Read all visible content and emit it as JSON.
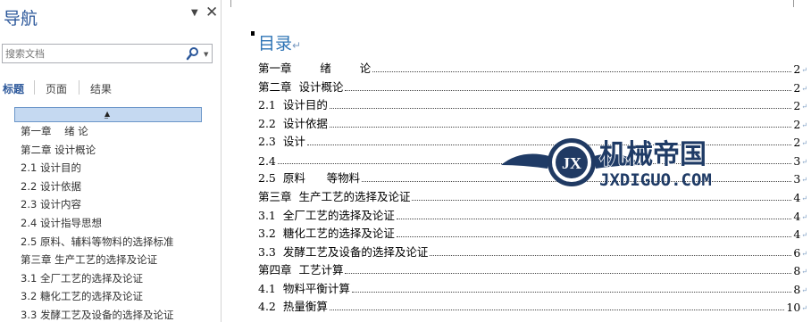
{
  "nav": {
    "title": "导航",
    "search_placeholder": "搜索文档",
    "tabs": [
      "标题",
      "页面",
      "结果"
    ],
    "items": [
      "第一章    绪 论",
      "第二章 设计概论",
      "2.1 设计目的",
      "2.2 设计依据",
      "2.3 设计内容",
      "2.4 设计指导思想",
      "2.5 原料、辅料等物料的选择标准",
      "第三章 生产工艺的选择及论证",
      "3.1 全厂工艺的选择及论证",
      "3.2 糖化工艺的选择及论证",
      "3.3 发酵工艺及设备的选择及论证"
    ]
  },
  "document": {
    "toc_title": "目录",
    "toc": [
      {
        "text": "第一章        绪        论",
        "page": "2"
      },
      {
        "text": "第二章  设计概论",
        "page": "2"
      },
      {
        "text": "2.1  设计目的",
        "page": "2"
      },
      {
        "text": "2.2  设计依据",
        "page": "2"
      },
      {
        "text": "2.3  设计",
        "page": "2"
      },
      {
        "text": "2.4",
        "page": "3"
      },
      {
        "text": "2.5  原料      等物料",
        "page": "3"
      },
      {
        "text": "第三章  生产工艺的选择及论证",
        "page": "4"
      },
      {
        "text": "3.1  全厂工艺的选择及论证",
        "page": "4"
      },
      {
        "text": "3.2  糖化工艺的选择及论证",
        "page": "4"
      },
      {
        "text": "3.3  发酵工艺及设备的选择及论证",
        "page": "6"
      },
      {
        "text": "第四章  工艺计算",
        "page": "8"
      },
      {
        "text": "4.1  物料平衡计算",
        "page": "8"
      },
      {
        "text": "4.2  热量衡算",
        "page": "10"
      }
    ]
  },
  "watermark": {
    "logo_letters": "JX",
    "cn_text": "机械帝国",
    "en_text": "JXDIGUO.COM"
  },
  "colors": {
    "accent": "#2b579a",
    "toc_title": "#2e74b5",
    "collapse_bar": "#c5d9f1"
  }
}
